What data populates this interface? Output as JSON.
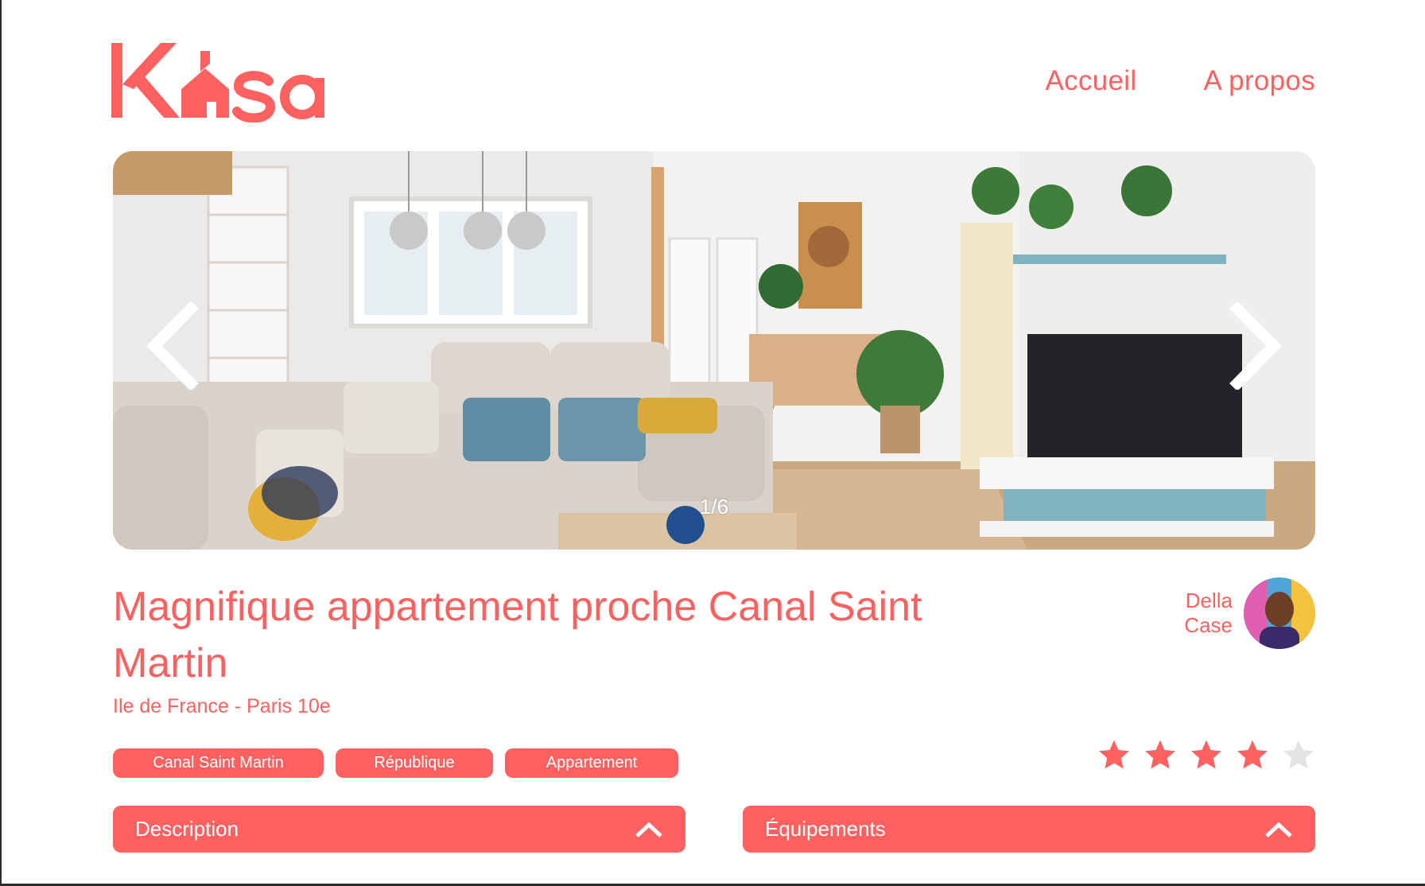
{
  "header": {
    "logo": {
      "text": "Kasa",
      "icon": "house-icon"
    },
    "nav": [
      {
        "label": "Accueil"
      },
      {
        "label": "A propos"
      }
    ]
  },
  "carousel": {
    "counter": "1/6",
    "prev_icon": "chevron-left-icon",
    "next_icon": "chevron-right-icon"
  },
  "listing": {
    "title": "Magnifique appartement proche Canal Saint Martin",
    "location": "Ile de France - Paris 10e",
    "host": {
      "first_name": "Della",
      "last_name": "Case"
    },
    "tags": [
      "Canal Saint Martin",
      "République",
      "Appartement"
    ],
    "rating": 4,
    "rating_max": 5
  },
  "collapses": {
    "description": {
      "title": "Description"
    },
    "equipments": {
      "title": "Équipements"
    }
  },
  "colors": {
    "accent": "#FF6060",
    "star_empty": "#E3E3E3",
    "white": "#FFFFFF"
  }
}
